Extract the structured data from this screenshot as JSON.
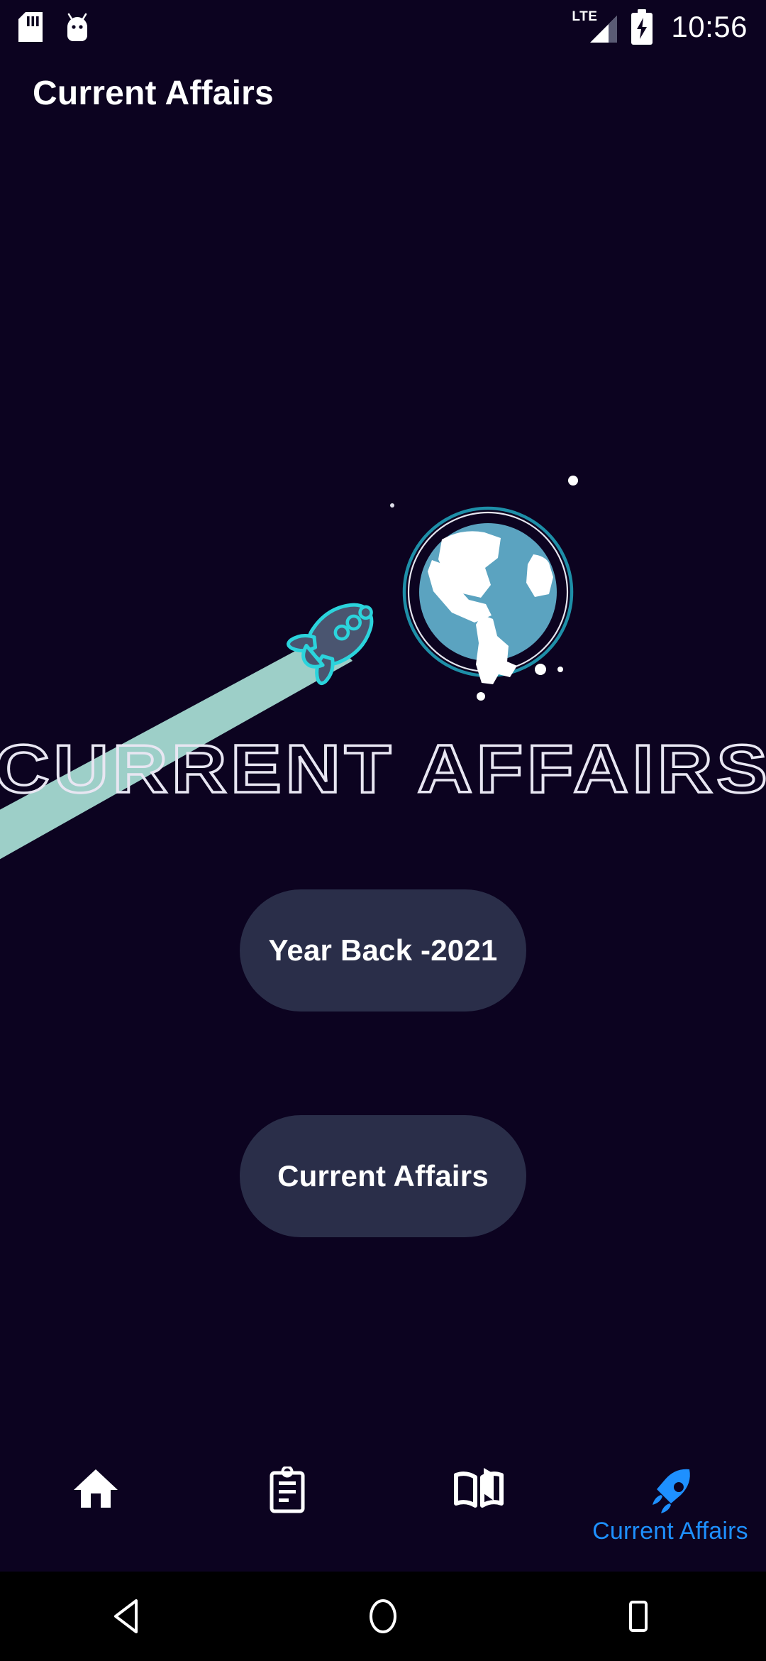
{
  "status_bar": {
    "icons": [
      "sd-card-icon",
      "android-head-icon"
    ],
    "network": "LTE",
    "battery": "charging",
    "time": "10:56"
  },
  "app_bar": {
    "title": "Current Affairs"
  },
  "hero": {
    "logo_text": "CURRENT AFFAIRS",
    "graphics": [
      "globe-illustration",
      "rocket-illustration",
      "rocket-trail",
      "star-dots"
    ],
    "colors": {
      "background": "#0C0320",
      "globe_ocean": "#5BA3C0",
      "globe_land": "#FFFFFF",
      "globe_ring": "#1E8FA8",
      "rocket_outline": "#2BD4DC",
      "rocket_body": "#4A5570",
      "rocket_trail": "#9DCFC8",
      "logo_stroke": "#E8E6F2"
    }
  },
  "buttons": [
    {
      "id": "year-back",
      "label": "Year Back -2021"
    },
    {
      "id": "current-affairs",
      "label": "Current Affairs"
    }
  ],
  "bottom_nav": {
    "active_index": 3,
    "active_color": "#1E90FF",
    "inactive_color": "#FFFFFF",
    "items": [
      {
        "icon": "home-icon",
        "label": ""
      },
      {
        "icon": "clipboard-icon",
        "label": ""
      },
      {
        "icon": "book-icon",
        "label": ""
      },
      {
        "icon": "rocket-icon",
        "label": "Current Affairs"
      }
    ]
  },
  "android_nav": {
    "buttons": [
      "back-button",
      "home-button",
      "recents-button"
    ]
  }
}
